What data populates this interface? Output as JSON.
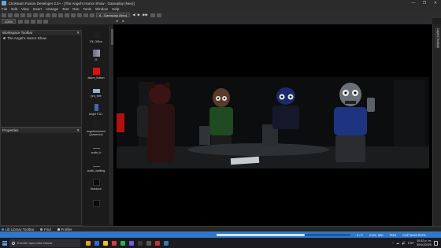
{
  "window": {
    "title": "Clickteam Fusion Developer 2.5+ - [The Angel's Horror Show - Gameplay (Neo)]",
    "controls": [
      "—",
      "❐",
      "✕"
    ]
  },
  "menubar": [
    "File",
    "Edit",
    "View",
    "Insert",
    "Arrange",
    "Test",
    "Run",
    "Tools",
    "Window",
    "Help"
  ],
  "toolbar": {
    "zoom": "100%",
    "frame_dropdown": "6 - Gameplay (Neo)",
    "play_symbol": "▶",
    "step_symbols": [
      "◀",
      "▶",
      "▶▶"
    ]
  },
  "workspace": {
    "title": "Workspace Toolbar",
    "close": "✕",
    "items": [
      {
        "label": "The Angel's Horror Show"
      }
    ]
  },
  "properties": {
    "title": "Properties",
    "close": "✕"
  },
  "object_bar": [
    {
      "label": "Elf_Office",
      "color": "#1e1e1e"
    },
    {
      "label": "III",
      "color": "#8b8b9b"
    },
    {
      "label": "alarm_button",
      "color": "#e01010"
    },
    {
      "label": "pro_text",
      "color": "#9ab0c8"
    },
    {
      "label": "Angel F.A.I.",
      "color": "#4466aa"
    },
    {
      "label": "angelfuntomen\n(powerout)",
      "color": "#1e1e1e"
    },
    {
      "label": "audio_b",
      "color": "#1e1e1e"
    },
    {
      "label": "audio_walking",
      "color": "#1e1e1e"
    },
    {
      "label": "blackout",
      "color": "#0a0a0a"
    },
    {
      "label": "",
      "color": "#0a0a0a"
    }
  ],
  "layout": {
    "nav_left": "◂",
    "nav_right": "▸"
  },
  "side_panel": {
    "tab": "Layers Toolbar"
  },
  "bottom_tabs": [
    {
      "label": "Lib Library Toolbar",
      "color": "#4a90d9"
    },
    {
      "label": "Find",
      "color": "#aaaaaa"
    },
    {
      "label": "Profiler",
      "color": "#dddddd"
    }
  ],
  "status": {
    "progress_fraction": 0.66,
    "coords": "0 / 0",
    "position": "2102, 590",
    "size_label": "PNG",
    "extra": "CAP NUM SCRL"
  },
  "taskbar": {
    "search_placeholder": "Escribe aquí para buscar",
    "apps": [
      "#e8a21a",
      "#2a6fd6",
      "#f0c419",
      "#d43f3f",
      "#1db954",
      "#7b5cd6",
      "#3a3a3a",
      "#5a5a5a",
      "#c0392b",
      "#2980b9"
    ],
    "tray_icons": [
      "^",
      "☁",
      "🔊",
      "ESP"
    ],
    "time": "10:32 p. m.",
    "date": "30/10/2020"
  }
}
